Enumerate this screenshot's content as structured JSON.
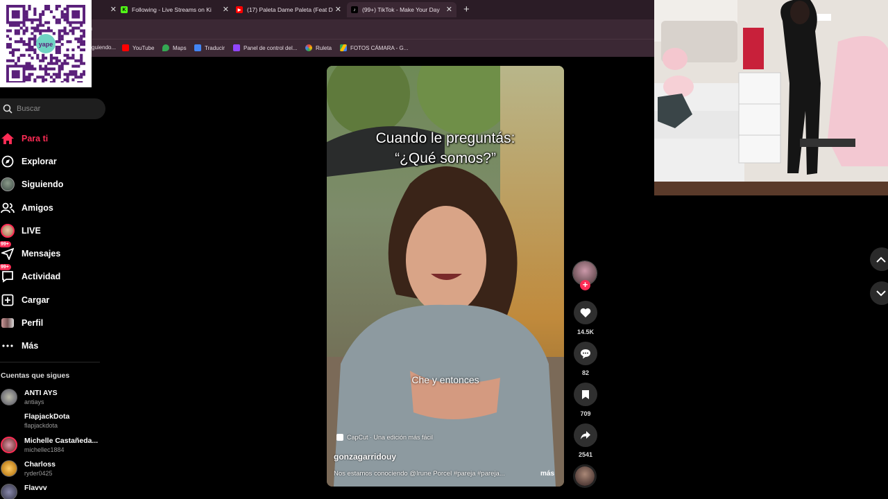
{
  "browser": {
    "tabs": [
      {
        "title": "Following - Live Streams on Ki",
        "icon": "kick-icon",
        "color": "#53fc18"
      },
      {
        "title": "(17) Paleta Dame Paleta (Feat D",
        "icon": "youtube-icon",
        "color": "#ff0000"
      },
      {
        "title": "(99+) TikTok - Make Your Day",
        "icon": "tiktok-icon",
        "color": "#ffffff"
      }
    ],
    "address_fragment": "n",
    "bookmarks": [
      {
        "label": "guiendo...",
        "color": "#444444"
      },
      {
        "label": "YouTube",
        "color": "#ff0000"
      },
      {
        "label": "Maps",
        "color": "#34a853"
      },
      {
        "label": "Traducir",
        "color": "#4285f4"
      },
      {
        "label": "Panel de control del...",
        "color": "#9146ff"
      },
      {
        "label": "Ruleta",
        "color": "#ea4335"
      },
      {
        "label": "FOTOS CÁMARA - G...",
        "color": "#fbbc04"
      }
    ]
  },
  "qr_overlay": {
    "brand": "yape"
  },
  "sidebar": {
    "search_placeholder": "Buscar",
    "nav": [
      {
        "label": "Para ti",
        "icon": "home-icon",
        "active": true
      },
      {
        "label": "Explorar",
        "icon": "compass-icon"
      },
      {
        "label": "Siguiendo",
        "icon": "following-avatar-icon"
      },
      {
        "label": "Amigos",
        "icon": "friends-icon"
      },
      {
        "label": "LIVE",
        "icon": "live-icon"
      },
      {
        "label": "Mensajes",
        "icon": "messages-icon",
        "badge": "99+"
      },
      {
        "label": "Actividad",
        "icon": "activity-icon",
        "badge": "99+"
      },
      {
        "label": "Cargar",
        "icon": "upload-icon"
      },
      {
        "label": "Perfil",
        "icon": "profile-icon"
      },
      {
        "label": "Más",
        "icon": "more-icon"
      }
    ],
    "following_title": "Cuentas que sigues",
    "accounts": [
      {
        "name": "ANTI AYS",
        "handle": "antiays"
      },
      {
        "name": "FlapjackDota",
        "handle": "flapjackdota"
      },
      {
        "name": "Michelle Castañeda...",
        "handle": "michellec1884"
      },
      {
        "name": "Charloss",
        "handle": "ryder0425"
      },
      {
        "name": "Flavvv",
        "handle": ""
      }
    ]
  },
  "video": {
    "caption_line1": "Cuando le preguntás:",
    "caption_line2": "“¿Qué somos?”",
    "subtitle": "Che y entonces",
    "capcut": "CapCut · Una edición más fácil",
    "author": "gonzagarridouy",
    "description": "Nos estamos conociendo @Irune Porcel #pareja #pareja...",
    "more": "más"
  },
  "actions": {
    "likes": "14.5K",
    "comments": "82",
    "saves": "709",
    "shares": "2541"
  },
  "colors": {
    "accent": "#fe2c55"
  }
}
